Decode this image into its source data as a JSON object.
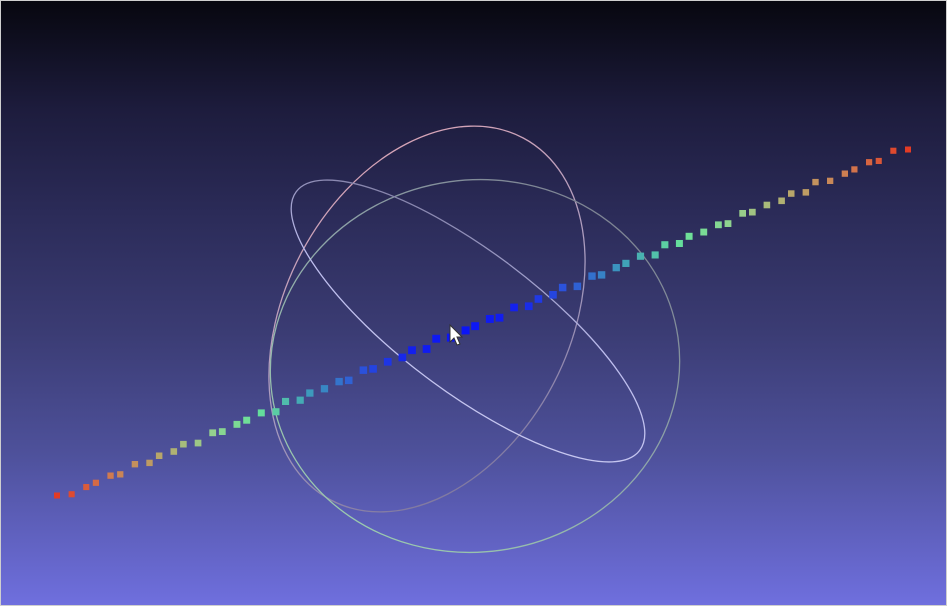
{
  "viewer": {
    "background_top": "#07070f",
    "background_bottom": "#6f6fde"
  },
  "trackball": {
    "ring_colors": [
      "#e3a4b0",
      "#9ad4a8",
      "#b7b7e7"
    ],
    "cursor_icon": "arrow-cursor-icon"
  },
  "point_cloud": {
    "color_ramp": [
      "#e33b25",
      "#d0794f",
      "#b9a569",
      "#96d08d",
      "#67e29a",
      "#3ea0b9",
      "#2d56d9",
      "#1420ed",
      "#0a14f7"
    ]
  }
}
